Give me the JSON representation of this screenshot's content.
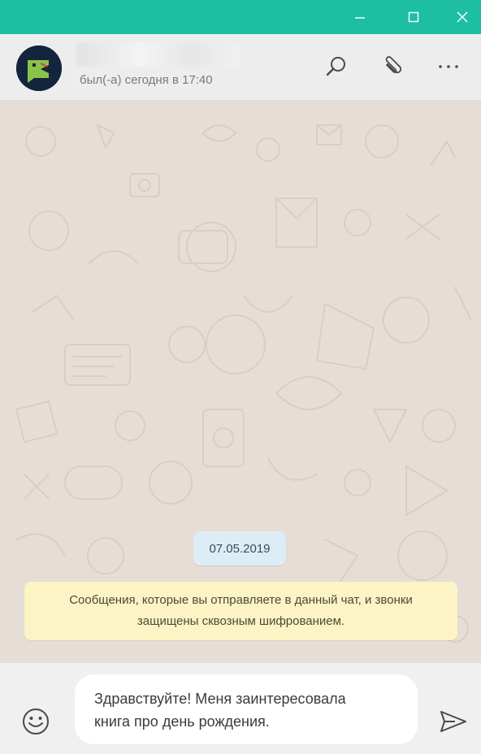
{
  "window": {
    "accent_color": "#1ebea5",
    "controls": [
      "minimize-icon",
      "maximize-icon",
      "close-icon"
    ]
  },
  "header": {
    "contact_name": "",
    "status": "был(-а) сегодня в 17:40",
    "icons": [
      "search-icon",
      "paperclip-icon",
      "more-icon"
    ]
  },
  "chat": {
    "date": "07.05.2019",
    "encryption_notice": "Сообщения, которые вы отправляете в данный чат, и звонки защищены сквозным шифрованием."
  },
  "composer": {
    "message": "Здравствуйте! Меня заинтересовала\nкнига про день рождения.",
    "emoji_icon": "emoji-icon",
    "send_icon": "send-icon"
  }
}
